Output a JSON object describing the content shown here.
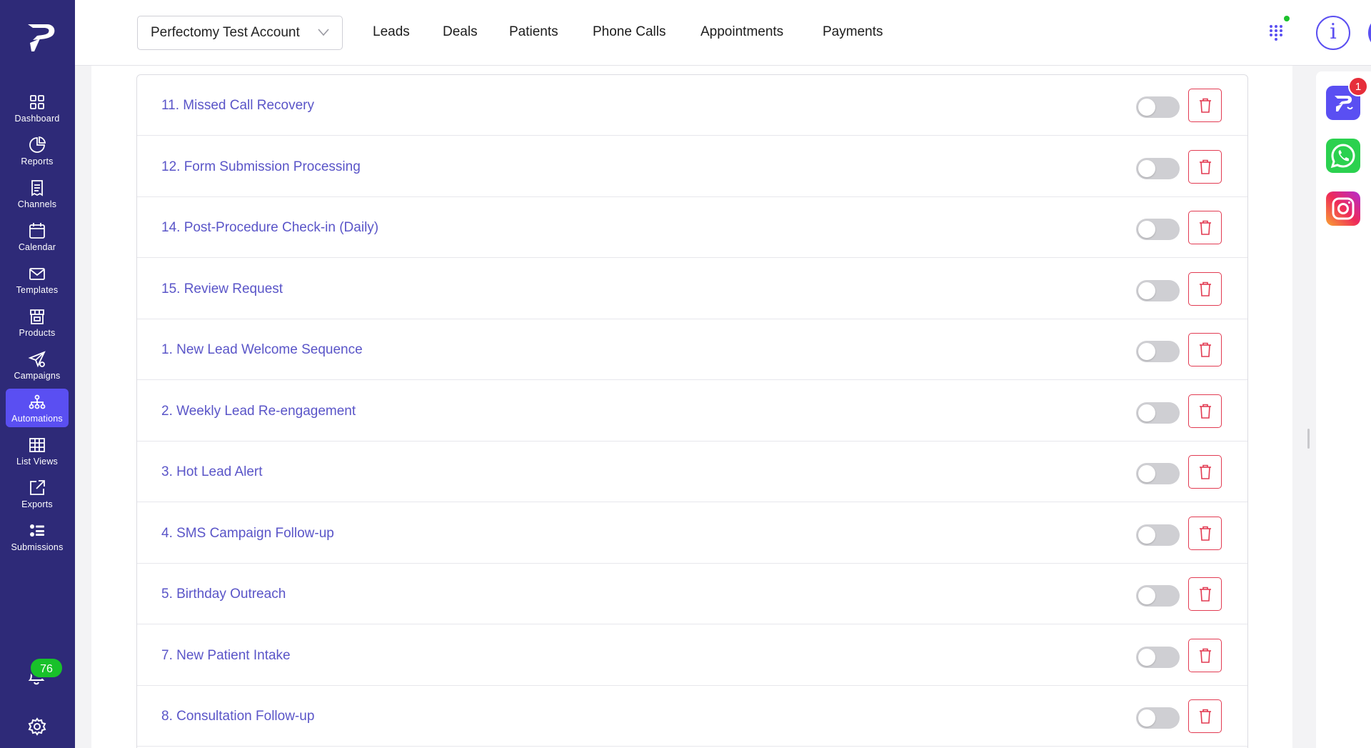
{
  "app": {
    "brand_color": "#5a4ff2",
    "sidebar_color": "#2e2a78"
  },
  "sidebar": {
    "items": [
      {
        "label": "Dashboard",
        "icon": "grid-icon"
      },
      {
        "label": "Reports",
        "icon": "pie-chart-icon"
      },
      {
        "label": "Channels",
        "icon": "document-list-icon"
      },
      {
        "label": "Calendar",
        "icon": "calendar-icon"
      },
      {
        "label": "Templates",
        "icon": "envelope-icon"
      },
      {
        "label": "Products",
        "icon": "store-icon"
      },
      {
        "label": "Campaigns",
        "icon": "paper-plane-icon"
      },
      {
        "label": "Automations",
        "icon": "hierarchy-icon",
        "active": true
      },
      {
        "label": "List Views",
        "icon": "table-icon"
      },
      {
        "label": "Exports",
        "icon": "export-icon"
      },
      {
        "label": "Submissions",
        "icon": "checklist-icon"
      }
    ],
    "notification_count": "76"
  },
  "header": {
    "account_selector": "Perfectomy Test Account",
    "nav": [
      "Leads",
      "Deals",
      "Patients",
      "Phone Calls",
      "Appointments",
      "Payments"
    ],
    "info_label": "i"
  },
  "automations": {
    "rows": [
      {
        "title": "11. Missed Call Recovery",
        "enabled": false
      },
      {
        "title": "12. Form Submission Processing",
        "enabled": false
      },
      {
        "title": "14. Post-Procedure Check-in (Daily)",
        "enabled": false
      },
      {
        "title": "15. Review Request",
        "enabled": false
      },
      {
        "title": "1. New Lead Welcome Sequence",
        "enabled": false
      },
      {
        "title": "2. Weekly Lead Re-engagement",
        "enabled": false
      },
      {
        "title": "3. Hot Lead Alert",
        "enabled": false
      },
      {
        "title": "4. SMS Campaign Follow-up",
        "enabled": false
      },
      {
        "title": "5. Birthday Outreach",
        "enabled": false
      },
      {
        "title": "7. New Patient Intake",
        "enabled": false
      },
      {
        "title": "8. Consultation Follow-up",
        "enabled": false
      }
    ]
  },
  "right_rail": {
    "messenger_badge": "1",
    "apps": [
      "perfectomy-messenger-icon",
      "whatsapp-icon",
      "instagram-icon"
    ]
  }
}
